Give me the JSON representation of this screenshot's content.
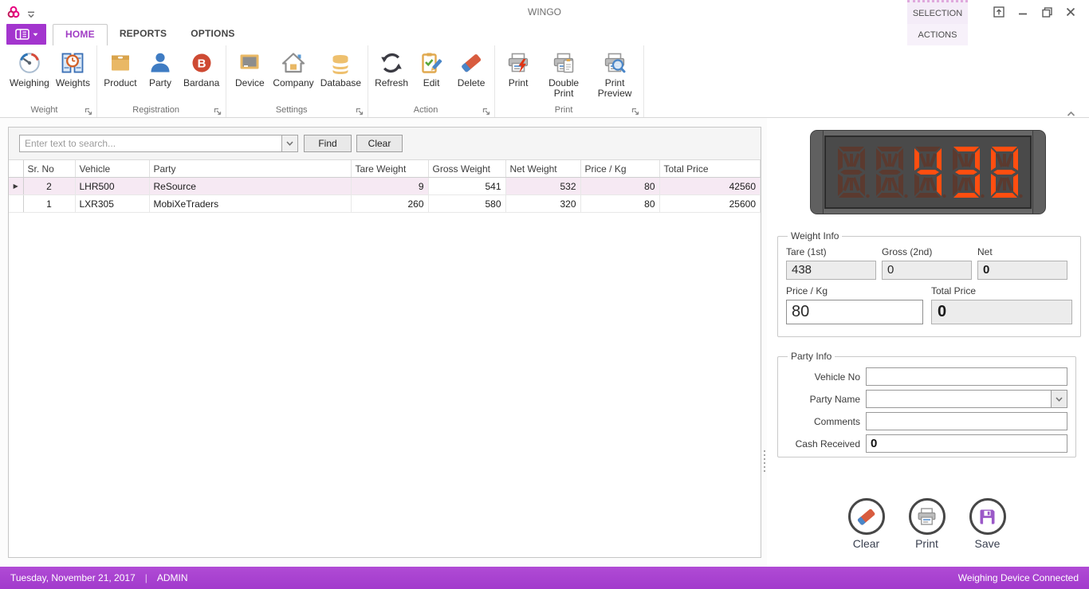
{
  "window": {
    "title": "WINGO",
    "contextual_group_label": "SELECTION",
    "contextual_tab_label": "ACTIONS"
  },
  "ribbon": {
    "tabs": [
      {
        "label": "HOME",
        "active": true
      },
      {
        "label": "REPORTS",
        "active": false
      },
      {
        "label": "OPTIONS",
        "active": false
      }
    ],
    "groups": [
      {
        "label": "Weight",
        "buttons": [
          {
            "label": "Weighing",
            "icon": "gauge-icon"
          },
          {
            "label": "Weights",
            "icon": "weights-clock-icon"
          }
        ]
      },
      {
        "label": "Registration",
        "buttons": [
          {
            "label": "Product",
            "icon": "product-box-icon"
          },
          {
            "label": "Party",
            "icon": "person-icon"
          },
          {
            "label": "Bardana",
            "icon": "bardana-icon"
          }
        ]
      },
      {
        "label": "Settings",
        "buttons": [
          {
            "label": "Device",
            "icon": "device-icon"
          },
          {
            "label": "Company",
            "icon": "company-icon"
          },
          {
            "label": "Database",
            "icon": "database-icon"
          }
        ]
      },
      {
        "label": "Action",
        "buttons": [
          {
            "label": "Refresh",
            "icon": "refresh-icon"
          },
          {
            "label": "Edit",
            "icon": "edit-icon"
          },
          {
            "label": "Delete",
            "icon": "delete-eraser-icon"
          }
        ]
      },
      {
        "label": "Print",
        "buttons": [
          {
            "label": "Print",
            "icon": "print-icon"
          },
          {
            "label": "Double Print",
            "icon": "double-print-icon"
          },
          {
            "label": "Print Preview",
            "icon": "print-preview-icon"
          }
        ]
      }
    ]
  },
  "search": {
    "placeholder": "Enter text to search...",
    "find_label": "Find",
    "clear_label": "Clear"
  },
  "table": {
    "columns": [
      "Sr. No",
      "Vehicle",
      "Party",
      "Tare Weight",
      "Gross Weight",
      "Net Weight",
      "Price / Kg",
      "Total Price"
    ],
    "rows": [
      {
        "sr_no": "2",
        "vehicle": "LHR500",
        "party": "ReSource",
        "tare_weight": "9",
        "gross_weight": "541",
        "net_weight": "532",
        "price_kg": "80",
        "total_price": "42560",
        "selected": true
      },
      {
        "sr_no": "1",
        "vehicle": "LXR305",
        "party": "MobiXeTraders",
        "tare_weight": "260",
        "gross_weight": "580",
        "net_weight": "320",
        "price_kg": "80",
        "total_price": "25600",
        "selected": false
      }
    ],
    "focused_cell": {
      "row": 0,
      "column": "gross_weight"
    }
  },
  "led_display": {
    "value": "438",
    "digit_count": 5
  },
  "weight_info": {
    "title": "Weight Info",
    "tare_label": "Tare (1st)",
    "tare_value": "438",
    "gross_label": "Gross (2nd)",
    "gross_value": "0",
    "net_label": "Net",
    "net_value": "0",
    "price_label": "Price / Kg",
    "price_value": "80",
    "total_label": "Total Price",
    "total_value": "0"
  },
  "party_info": {
    "title": "Party Info",
    "vehicle_label": "Vehicle No",
    "vehicle_value": "",
    "party_label": "Party Name",
    "party_value": "",
    "comments_label": "Comments",
    "comments_value": "",
    "cash_label": "Cash Received",
    "cash_value": "0"
  },
  "action_buttons": [
    {
      "label": "Clear",
      "icon": "eraser-circle-icon"
    },
    {
      "label": "Print",
      "icon": "printer-circle-icon"
    },
    {
      "label": "Save",
      "icon": "floppy-circle-icon"
    }
  ],
  "status_bar": {
    "date": "Tuesday, November 21, 2017",
    "separator": "|",
    "user": "ADMIN",
    "device_status": "Weighing Device Connected"
  },
  "colors": {
    "accent_purple": "#a335ce",
    "status_bar_purple": "#a23acc",
    "home_tab_text": "#a03cc4",
    "selected_row_bg": "#f6e9f3",
    "led_lit": "#ff4e10",
    "led_dim": "#5b3a2f",
    "contextual_bg": "#f4ecf8"
  }
}
